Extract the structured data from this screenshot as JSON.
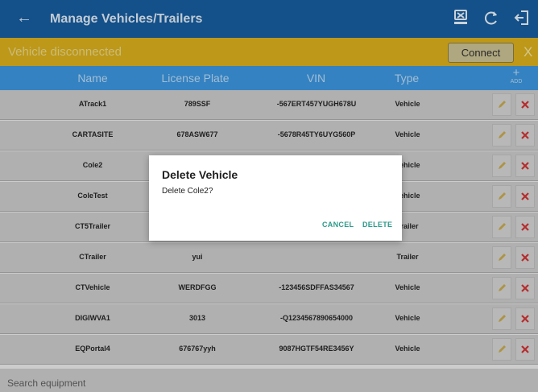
{
  "topbar": {
    "title": "Manage Vehicles/Trailers",
    "icons": [
      "back-arrow-icon",
      "export-device-icon",
      "refresh-icon",
      "logout-icon"
    ],
    "background_color": "#175c9c"
  },
  "status": {
    "text": "Vehicle disconnected",
    "connect_label": "Connect",
    "close_label": "X",
    "background_color": "#d8ae1d"
  },
  "table": {
    "headers": {
      "name": "Name",
      "plate": "License Plate",
      "vin": "VIN",
      "type": "Type",
      "add_plus": "+",
      "add_label": "ADD"
    },
    "rows": [
      {
        "name": "ATrack1",
        "plate": "789SSF",
        "vin": "-567ERT457YUGH678U",
        "type": "Vehicle"
      },
      {
        "name": "CARTASITE",
        "plate": "678ASW677",
        "vin": "-5678R45TY6UYG560P",
        "type": "Vehicle"
      },
      {
        "name": "Cole2",
        "plate": "",
        "vin": "",
        "type": "Vehicle"
      },
      {
        "name": "ColeTest",
        "plate": "",
        "vin": "",
        "type": "Vehicle"
      },
      {
        "name": "CT5Trailer",
        "plate": "",
        "vin": "",
        "type": "Trailer"
      },
      {
        "name": "CTrailer",
        "plate": "yui",
        "vin": "",
        "type": "Trailer"
      },
      {
        "name": "CTVehicle",
        "plate": "WERDFGG",
        "vin": "-123456SDFFAS34567",
        "type": "Vehicle"
      },
      {
        "name": "DIGIWVA1",
        "plate": "3013",
        "vin": "-Q1234567890654000",
        "type": "Vehicle"
      },
      {
        "name": "EQPortal4",
        "plate": "676767yyh",
        "vin": "9087HGTF54RE3456Y",
        "type": "Vehicle"
      }
    ],
    "row_icons": [
      "pencil-icon",
      "delete-x-icon"
    ],
    "header_color": "#3c95dc"
  },
  "search": {
    "placeholder": "Search equipment",
    "value": ""
  },
  "dialog": {
    "title": "Delete Vehicle",
    "message": "Delete Cole2?",
    "cancel_label": "CANCEL",
    "delete_label": "DELETE",
    "accent_color": "#2b9a8a"
  }
}
